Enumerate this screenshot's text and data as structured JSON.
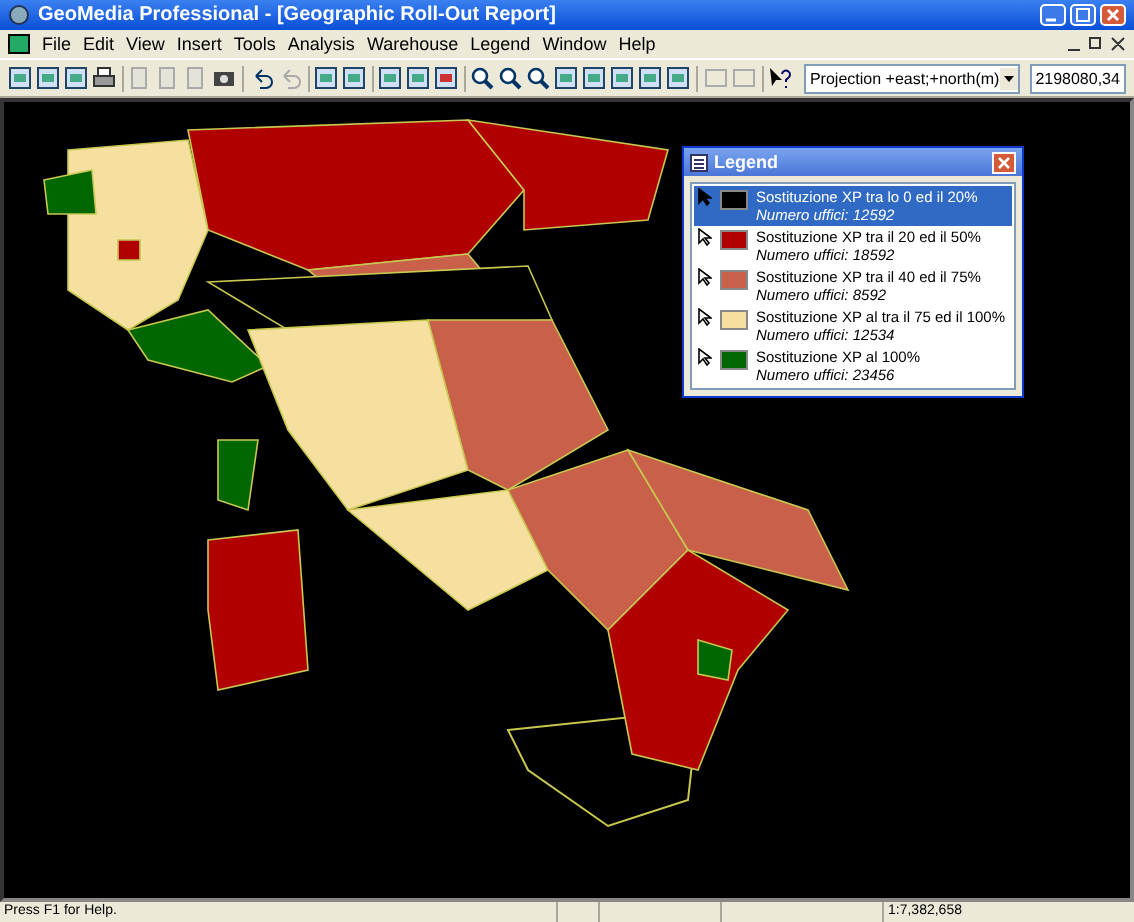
{
  "window": {
    "title": "GeoMedia Professional - [Geographic Roll-Out Report]"
  },
  "menu": [
    "File",
    "Edit",
    "View",
    "Insert",
    "Tools",
    "Analysis",
    "Warehouse",
    "Legend",
    "Window",
    "Help"
  ],
  "toolbar": {
    "projection": "Projection +east;+north(m)",
    "coordinate": "2198080,34"
  },
  "legend": {
    "title": "Legend",
    "items": [
      {
        "label": "Sostituzione XP tra lo 0 ed il 20%",
        "count": "Numero uffici: 12592",
        "color": "#000000",
        "selected": true
      },
      {
        "label": "Sostituzione XP tra il 20 ed il 50%",
        "count": "Numero uffici: 18592",
        "color": "#b00000",
        "selected": false
      },
      {
        "label": "Sostituzione XP tra il 40 ed il 75%",
        "count": "Numero uffici: 8592",
        "color": "#c8604a",
        "selected": false
      },
      {
        "label": "Sostituzione XP al tra il 75 ed il 100%",
        "count": "Numero uffici: 12534",
        "color": "#f5e0a0",
        "selected": false
      },
      {
        "label": "Sostituzione XP al 100%",
        "count": "Numero uffici: 23456",
        "color": "#006600",
        "selected": false
      }
    ]
  },
  "status_bar": {
    "message": "Press F1 for Help.",
    "scale": "1:7,382,658"
  }
}
